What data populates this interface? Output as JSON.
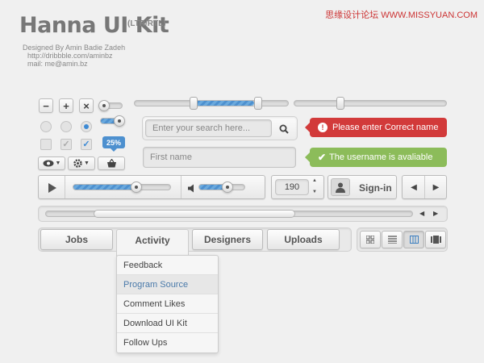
{
  "header": {
    "title": "Hanna UI Kit",
    "title_sub": "(LTR/RTL)",
    "credit_line": "Designed By Amin Badie Zadeh",
    "credit_url": "http://dribbble.com/aminbz",
    "credit_mail": "mail: me@amin.bz",
    "watermark": "思缘设计论坛  WWW.MISSYUAN.COM"
  },
  "controls": {
    "minus_label": "−",
    "plus_label": "+",
    "close_label": "×",
    "check_mark": "✓",
    "percent_badge": "25%"
  },
  "search": {
    "placeholder": "Enter your search here...",
    "search_icon": "magnifier-icon"
  },
  "form": {
    "first_name_placeholder": "First name"
  },
  "alerts": {
    "error_text": "Please enter Correct name",
    "success_text": "The username is avaliable",
    "error_color": "#d23a3a",
    "success_color": "#8cbc5a"
  },
  "player": {
    "progress": 0.65,
    "volume": 0.6
  },
  "stepper": {
    "value": "190"
  },
  "signin": {
    "label": "Sign-in"
  },
  "pager": {
    "prev_icon": "◀",
    "next_icon": "▶"
  },
  "scrollbar": {
    "thumb_start": 0.13,
    "thumb_end": 0.68
  },
  "tabs": [
    {
      "label": "Jobs"
    },
    {
      "label": "Activity"
    },
    {
      "label": "Designers"
    },
    {
      "label": "Uploads"
    }
  ],
  "dropdown": {
    "items": [
      {
        "label": "Feedback"
      },
      {
        "label": "Program Source"
      },
      {
        "label": "Comment Likes"
      },
      {
        "label": "Download UI Kit"
      },
      {
        "label": "Follow Ups"
      }
    ]
  },
  "sliders": {
    "top_range_low": 0.41,
    "top_range_high": 0.82,
    "right_slider": 0.32
  },
  "accent_color": "#4d90cf"
}
